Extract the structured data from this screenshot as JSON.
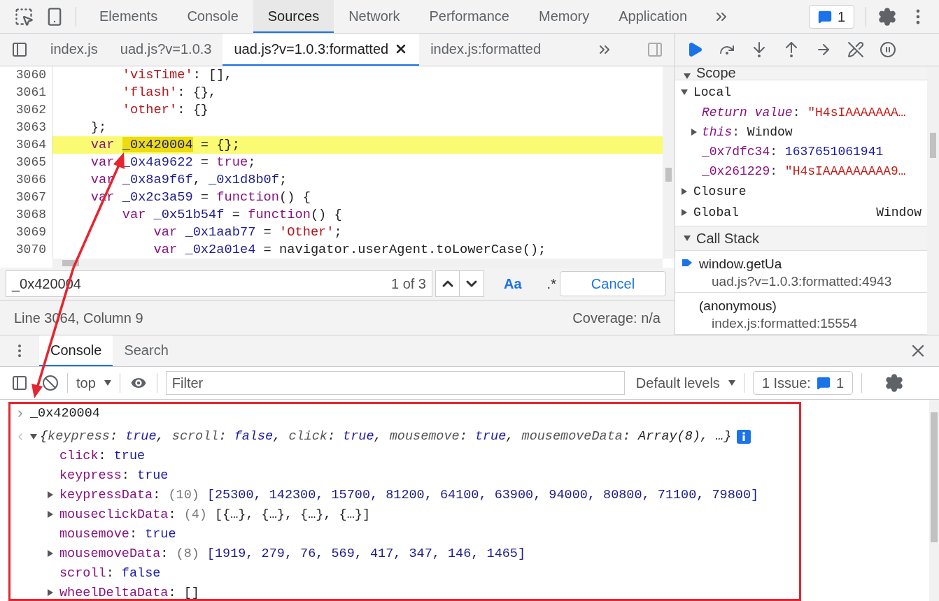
{
  "main_tabs": [
    {
      "label": "Elements",
      "selected": false
    },
    {
      "label": "Console",
      "selected": false
    },
    {
      "label": "Sources",
      "selected": true
    },
    {
      "label": "Network",
      "selected": false
    },
    {
      "label": "Performance",
      "selected": false
    },
    {
      "label": "Memory",
      "selected": false
    },
    {
      "label": "Application",
      "selected": false
    }
  ],
  "issues_count": "1",
  "file_tabs": [
    {
      "label": "index.js",
      "selected": false
    },
    {
      "label": "uad.js?v=1.0.3",
      "selected": false
    },
    {
      "label": "uad.js?v=1.0.3:formatted",
      "selected": true
    },
    {
      "label": "index.js:formatted",
      "selected": false
    }
  ],
  "code_lines": [
    {
      "number": "3060",
      "highlighted": false,
      "tokens": [
        {
          "kind": "str",
          "text": "        'visTime'"
        },
        {
          "kind": "plain",
          "text": ": [],"
        }
      ]
    },
    {
      "number": "3061",
      "highlighted": false,
      "tokens": [
        {
          "kind": "str",
          "text": "        'flash'"
        },
        {
          "kind": "plain",
          "text": ": {},"
        }
      ]
    },
    {
      "number": "3062",
      "highlighted": false,
      "tokens": [
        {
          "kind": "str",
          "text": "        'other'"
        },
        {
          "kind": "plain",
          "text": ": {}"
        }
      ]
    },
    {
      "number": "3063",
      "highlighted": false,
      "tokens": [
        {
          "kind": "plain",
          "text": "    };"
        }
      ]
    },
    {
      "number": "3064",
      "highlighted": true,
      "tokens": [
        {
          "kind": "kw",
          "text": "    var "
        },
        {
          "kind": "match",
          "text": "_0x420004"
        },
        {
          "kind": "plain",
          "text": " = {};"
        }
      ]
    },
    {
      "number": "3065",
      "highlighted": false,
      "tokens": [
        {
          "kind": "kw",
          "text": "    var "
        },
        {
          "kind": "id",
          "text": "_0x4a9622"
        },
        {
          "kind": "plain",
          "text": " = "
        },
        {
          "kind": "kw",
          "text": "true"
        },
        {
          "kind": "plain",
          "text": ";"
        }
      ]
    },
    {
      "number": "3066",
      "highlighted": false,
      "tokens": [
        {
          "kind": "kw",
          "text": "    var "
        },
        {
          "kind": "id",
          "text": "_0x8a9f6f"
        },
        {
          "kind": "plain",
          "text": ", "
        },
        {
          "kind": "id",
          "text": "_0x1d8b0f"
        },
        {
          "kind": "plain",
          "text": ";"
        }
      ]
    },
    {
      "number": "3067",
      "highlighted": false,
      "tokens": [
        {
          "kind": "kw",
          "text": "    var "
        },
        {
          "kind": "id",
          "text": "_0x2c3a59"
        },
        {
          "kind": "plain",
          "text": " = "
        },
        {
          "kind": "kw",
          "text": "function"
        },
        {
          "kind": "plain",
          "text": "() {"
        }
      ]
    },
    {
      "number": "3068",
      "highlighted": false,
      "tokens": [
        {
          "kind": "kw",
          "text": "        var "
        },
        {
          "kind": "id",
          "text": "_0x51b54f"
        },
        {
          "kind": "plain",
          "text": " = "
        },
        {
          "kind": "kw",
          "text": "function"
        },
        {
          "kind": "plain",
          "text": "() {"
        }
      ]
    },
    {
      "number": "3069",
      "highlighted": false,
      "tokens": [
        {
          "kind": "kw",
          "text": "            var "
        },
        {
          "kind": "id",
          "text": "_0x1aab77"
        },
        {
          "kind": "plain",
          "text": " = "
        },
        {
          "kind": "str",
          "text": "'Other'"
        },
        {
          "kind": "plain",
          "text": ";"
        }
      ]
    },
    {
      "number": "3070",
      "highlighted": false,
      "tokens": [
        {
          "kind": "kw",
          "text": "            var "
        },
        {
          "kind": "id",
          "text": "_0x2a01e4"
        },
        {
          "kind": "plain",
          "text": " = navigator.userAgent.toLowerCase();"
        }
      ]
    }
  ],
  "search": {
    "value": "_0x420004",
    "count": "1 of 3",
    "match_case": "Aa",
    "regex": ".*",
    "cancel": "Cancel"
  },
  "status": {
    "position": "Line 3064, Column 9",
    "coverage": "Coverage: n/a"
  },
  "scope": {
    "title": "Scope",
    "expanded": true,
    "separator": ": ",
    "groups": [
      {
        "name": "Local",
        "expanded": true,
        "items": [
          {
            "name": "Return value",
            "special": true,
            "expandable": false,
            "value": "\"H4sIAAAAAAA…",
            "kind": "string"
          },
          {
            "name": "this",
            "special": true,
            "expandable": true,
            "expanded": false,
            "value": "Window",
            "kind": "object"
          },
          {
            "name": "_0x7dfc34",
            "special": false,
            "expandable": false,
            "value": "1637651061941",
            "kind": "number"
          },
          {
            "name": "_0x261229",
            "special": false,
            "expandable": false,
            "value": "\"H4sIAAAAAAAAA9…",
            "kind": "string"
          }
        ]
      },
      {
        "name": "Closure",
        "expanded": false
      },
      {
        "name": "Global",
        "expanded": false,
        "value": "Window"
      }
    ]
  },
  "call_stack": {
    "title": "Call Stack",
    "expanded": true,
    "frames": [
      {
        "function": "window.getUa",
        "location": "uad.js?v=1.0.3:formatted:4943",
        "selected": true
      },
      {
        "function": "(anonymous)",
        "location": "index.js:formatted:15554",
        "selected": false
      }
    ]
  },
  "drawer_tabs": [
    {
      "label": "Console",
      "selected": true
    },
    {
      "label": "Search",
      "selected": false
    }
  ],
  "console_toolbar": {
    "context": "top",
    "filter_placeholder": "Filter",
    "levels": "Default levels",
    "issues_label": "1 Issue:",
    "issues_count": "1"
  },
  "console": {
    "input": "_0x420004",
    "result_expanded": true,
    "separator": ": ",
    "summary": [
      {
        "kind": "punct",
        "text": "{"
      },
      {
        "kind": "key",
        "text": "keypress"
      },
      {
        "kind": "punct",
        "text": ": "
      },
      {
        "kind": "bool",
        "text": "true"
      },
      {
        "kind": "punct",
        "text": ", "
      },
      {
        "kind": "key",
        "text": "scroll"
      },
      {
        "kind": "punct",
        "text": ": "
      },
      {
        "kind": "bool",
        "text": "false"
      },
      {
        "kind": "punct",
        "text": ", "
      },
      {
        "kind": "key",
        "text": "click"
      },
      {
        "kind": "punct",
        "text": ": "
      },
      {
        "kind": "bool",
        "text": "true"
      },
      {
        "kind": "punct",
        "text": ", "
      },
      {
        "kind": "key",
        "text": "mousemove"
      },
      {
        "kind": "punct",
        "text": ": "
      },
      {
        "kind": "bool",
        "text": "true"
      },
      {
        "kind": "punct",
        "text": ", "
      },
      {
        "kind": "key",
        "text": "mousemoveData"
      },
      {
        "kind": "punct",
        "text": ": "
      },
      {
        "kind": "other",
        "text": "Array(8)"
      },
      {
        "kind": "punct",
        "text": ", …}"
      }
    ],
    "properties": [
      {
        "key": "click",
        "expandable": false,
        "tokens": [
          {
            "kind": "bool",
            "text": "true"
          }
        ]
      },
      {
        "key": "keypress",
        "expandable": false,
        "tokens": [
          {
            "kind": "bool",
            "text": "true"
          }
        ]
      },
      {
        "key": "keypressData",
        "expandable": true,
        "expanded": false,
        "tokens": [
          {
            "kind": "count",
            "text": "(10)"
          },
          {
            "kind": "array",
            "text": "[25300, 142300, 15700, 81200, 64100, 63900, 94000, 80800, 71100, 79800]"
          }
        ]
      },
      {
        "key": "mouseclickData",
        "expandable": true,
        "expanded": false,
        "tokens": [
          {
            "kind": "count",
            "text": "(4)"
          },
          {
            "kind": "punct",
            "text": "[{…}, {…}, {…}, {…}]"
          }
        ]
      },
      {
        "key": "mousemove",
        "expandable": false,
        "tokens": [
          {
            "kind": "bool",
            "text": "true"
          }
        ]
      },
      {
        "key": "mousemoveData",
        "expandable": true,
        "expanded": false,
        "tokens": [
          {
            "kind": "count",
            "text": "(8)"
          },
          {
            "kind": "array",
            "text": "[1919, 279, 76, 569, 417, 347, 146, 1465]"
          }
        ]
      },
      {
        "key": "scroll",
        "expandable": false,
        "tokens": [
          {
            "kind": "bool",
            "text": "false"
          }
        ]
      },
      {
        "key": "wheelDeltaData",
        "expandable": true,
        "expanded": false,
        "tokens": [
          {
            "kind": "punct",
            "text": "[]"
          }
        ]
      }
    ]
  }
}
